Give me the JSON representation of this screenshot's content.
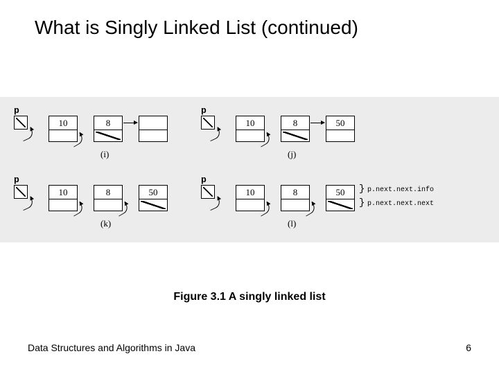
{
  "title": "What is Singly Linked List (continued)",
  "pointer_label": "p",
  "panels": {
    "i": {
      "label": "(i)",
      "nodes": [
        "10",
        "8",
        ""
      ]
    },
    "j": {
      "label": "(j)",
      "nodes": [
        "10",
        "8",
        "50"
      ]
    },
    "k": {
      "label": "(k)",
      "nodes": [
        "10",
        "8",
        "50"
      ]
    },
    "l": {
      "label": "(l)",
      "nodes": [
        "10",
        "8",
        "50"
      ]
    }
  },
  "annotations": {
    "line1": "p.next.next.info",
    "line2": "p.next.next.next"
  },
  "caption": "Figure 3.1 A singly linked list",
  "footer_left": "Data Structures and Algorithms in Java",
  "footer_right": "6"
}
